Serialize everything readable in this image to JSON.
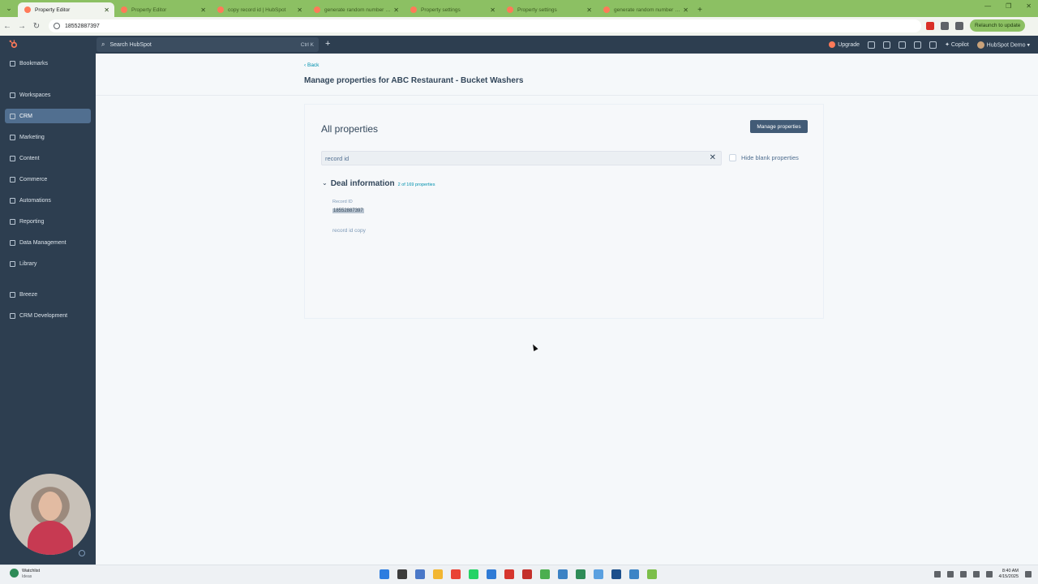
{
  "browser": {
    "tabs": [
      {
        "title": "Property Editor",
        "active": true
      },
      {
        "title": "Property Editor",
        "active": false
      },
      {
        "title": "copy record id | HubSpot",
        "active": false
      },
      {
        "title": "generate random number | HubSpot",
        "active": false
      },
      {
        "title": "Property settings",
        "active": false
      },
      {
        "title": "Property settings",
        "active": false
      },
      {
        "title": "generate random number (clone)",
        "active": false
      }
    ],
    "address": "18552887397",
    "relaunch_label": "Relaunch to update"
  },
  "hubspot_nav": {
    "search_placeholder": "Search HubSpot",
    "search_shortcut": "Ctrl K",
    "upgrade_label": "Upgrade",
    "copilot_label": "Copilot",
    "account_label": "HubSpot Demo"
  },
  "sidebar": {
    "items": [
      {
        "label": "Bookmarks"
      },
      {
        "label": "Workspaces"
      },
      {
        "label": "CRM",
        "active": true
      },
      {
        "label": "Marketing"
      },
      {
        "label": "Content"
      },
      {
        "label": "Commerce"
      },
      {
        "label": "Automations"
      },
      {
        "label": "Reporting"
      },
      {
        "label": "Data Management"
      },
      {
        "label": "Library"
      },
      {
        "label": "Breeze"
      },
      {
        "label": "CRM Development"
      }
    ]
  },
  "page": {
    "back_label": "Back",
    "title": "Manage properties for ABC Restaurant - Bucket Washers"
  },
  "card": {
    "title": "All properties",
    "manage_button": "Manage properties",
    "search_value": "record id",
    "hide_blank_label": "Hide blank properties",
    "hide_blank_checked": false,
    "section": {
      "title": "Deal information",
      "count": "2 of 169 properties",
      "properties": [
        {
          "label": "Record ID",
          "value": "18552887397"
        },
        {
          "label": "record id copy",
          "value": ""
        }
      ]
    }
  },
  "taskbar": {
    "watchlist_title": "Watchlist",
    "watchlist_sub": "Ideas",
    "time": "8:40 AM",
    "date": "4/15/2025"
  },
  "colors": {
    "tabstrip": "#8cc063",
    "hubspot_dark": "#2d3e50",
    "accent_link": "#0091ae",
    "button_dark": "#425b76"
  }
}
